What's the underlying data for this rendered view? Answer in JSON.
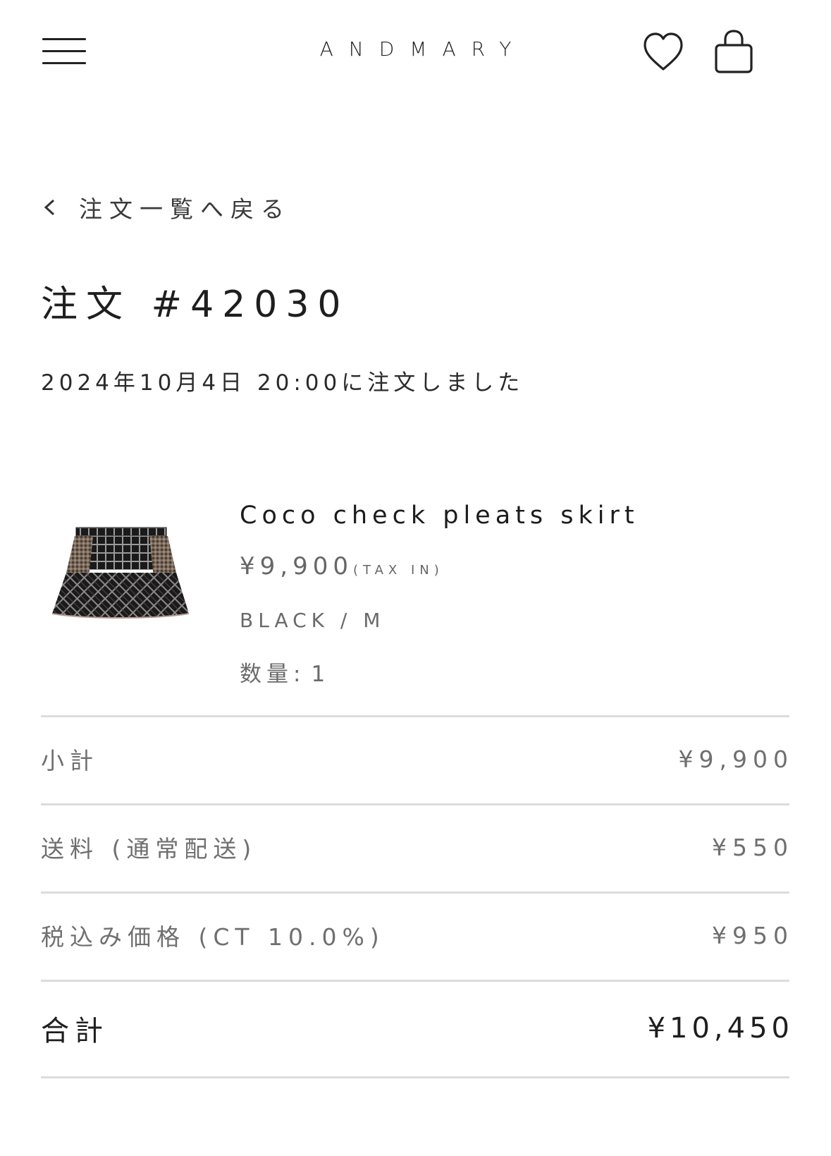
{
  "header": {
    "logo": "ANDMARY",
    "menu_icon": "hamburger-menu-icon",
    "wishlist_icon": "heart-icon",
    "cart_icon": "shopping-bag-icon"
  },
  "back": {
    "label": "注文一覧へ戻る",
    "icon": "chevron-left-icon"
  },
  "order": {
    "title": "注文 #42030",
    "date_text": "2024年10月4日 20:00に注文しました"
  },
  "product": {
    "name": "Coco check pleats skirt",
    "price": "¥9,900",
    "tax_note": "(TAX IN)",
    "variant": "BLACK / M",
    "qty_label": "数量:",
    "qty_value": "1"
  },
  "summary": {
    "subtotal_label": "小計",
    "subtotal_value": "¥9,900",
    "shipping_label": "送料 (通常配送)",
    "shipping_value": "¥550",
    "tax_label": "税込み価格 (CT 10.0%)",
    "tax_value": "¥950",
    "total_label": "合計",
    "total_value": "¥10,450"
  },
  "colors": {
    "text_primary": "#1f1f1f",
    "text_muted": "#6f6f6f",
    "divider": "#dcdcdc",
    "background": "#ffffff"
  }
}
